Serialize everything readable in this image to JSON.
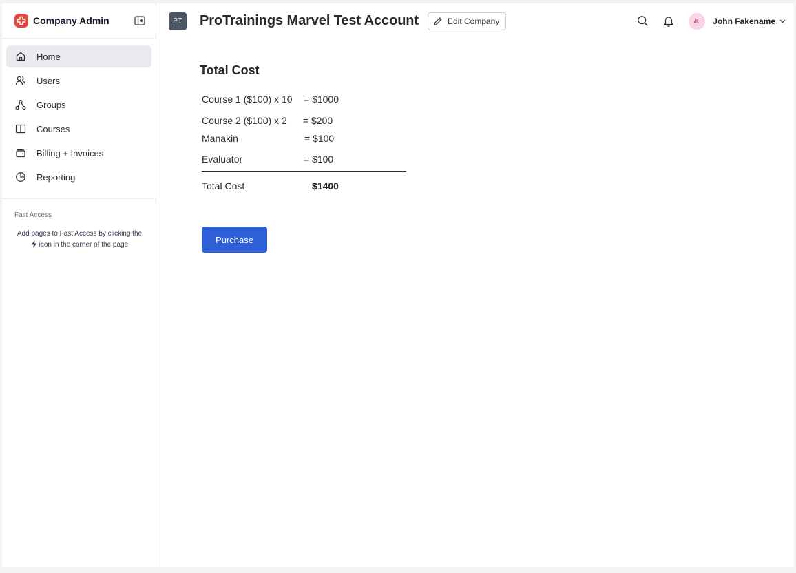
{
  "sidebar": {
    "brand_title": "Company Admin",
    "items": [
      {
        "label": "Home",
        "icon": "home-icon",
        "active": true
      },
      {
        "label": "Users",
        "icon": "users-icon"
      },
      {
        "label": "Groups",
        "icon": "groups-icon"
      },
      {
        "label": "Courses",
        "icon": "book-icon"
      },
      {
        "label": "Billing + Invoices",
        "icon": "wallet-icon"
      },
      {
        "label": "Reporting",
        "icon": "pie-chart-icon"
      }
    ],
    "fast_access": {
      "title": "Fast Access",
      "desc_before": "Add  pages to Fast Access by clicking the",
      "desc_after": "icon in the corner of the page"
    }
  },
  "header": {
    "company_initials": "PT",
    "company_name": "ProTrainings Marvel Test Account",
    "edit_label": "Edit Company",
    "user_initials": "JF",
    "user_name": "John Fakename"
  },
  "main": {
    "title": "Total Cost",
    "rows": [
      {
        "label": "Course 1 ($100) x 10",
        "value": "= $1000"
      },
      {
        "label": "Course 2 ($100) x 2",
        "value": " = $200"
      },
      {
        "label": "Manakin",
        "value": "= $100"
      },
      {
        "label": "Evaluator",
        "value": "= $100"
      }
    ],
    "total_label": "Total Cost",
    "total_value": "$1400",
    "purchase_label": "Purchase"
  },
  "colors": {
    "brand": "#e5483d",
    "primary_button": "#2f5fd6",
    "avatar_bg": "#fbd3e6"
  }
}
